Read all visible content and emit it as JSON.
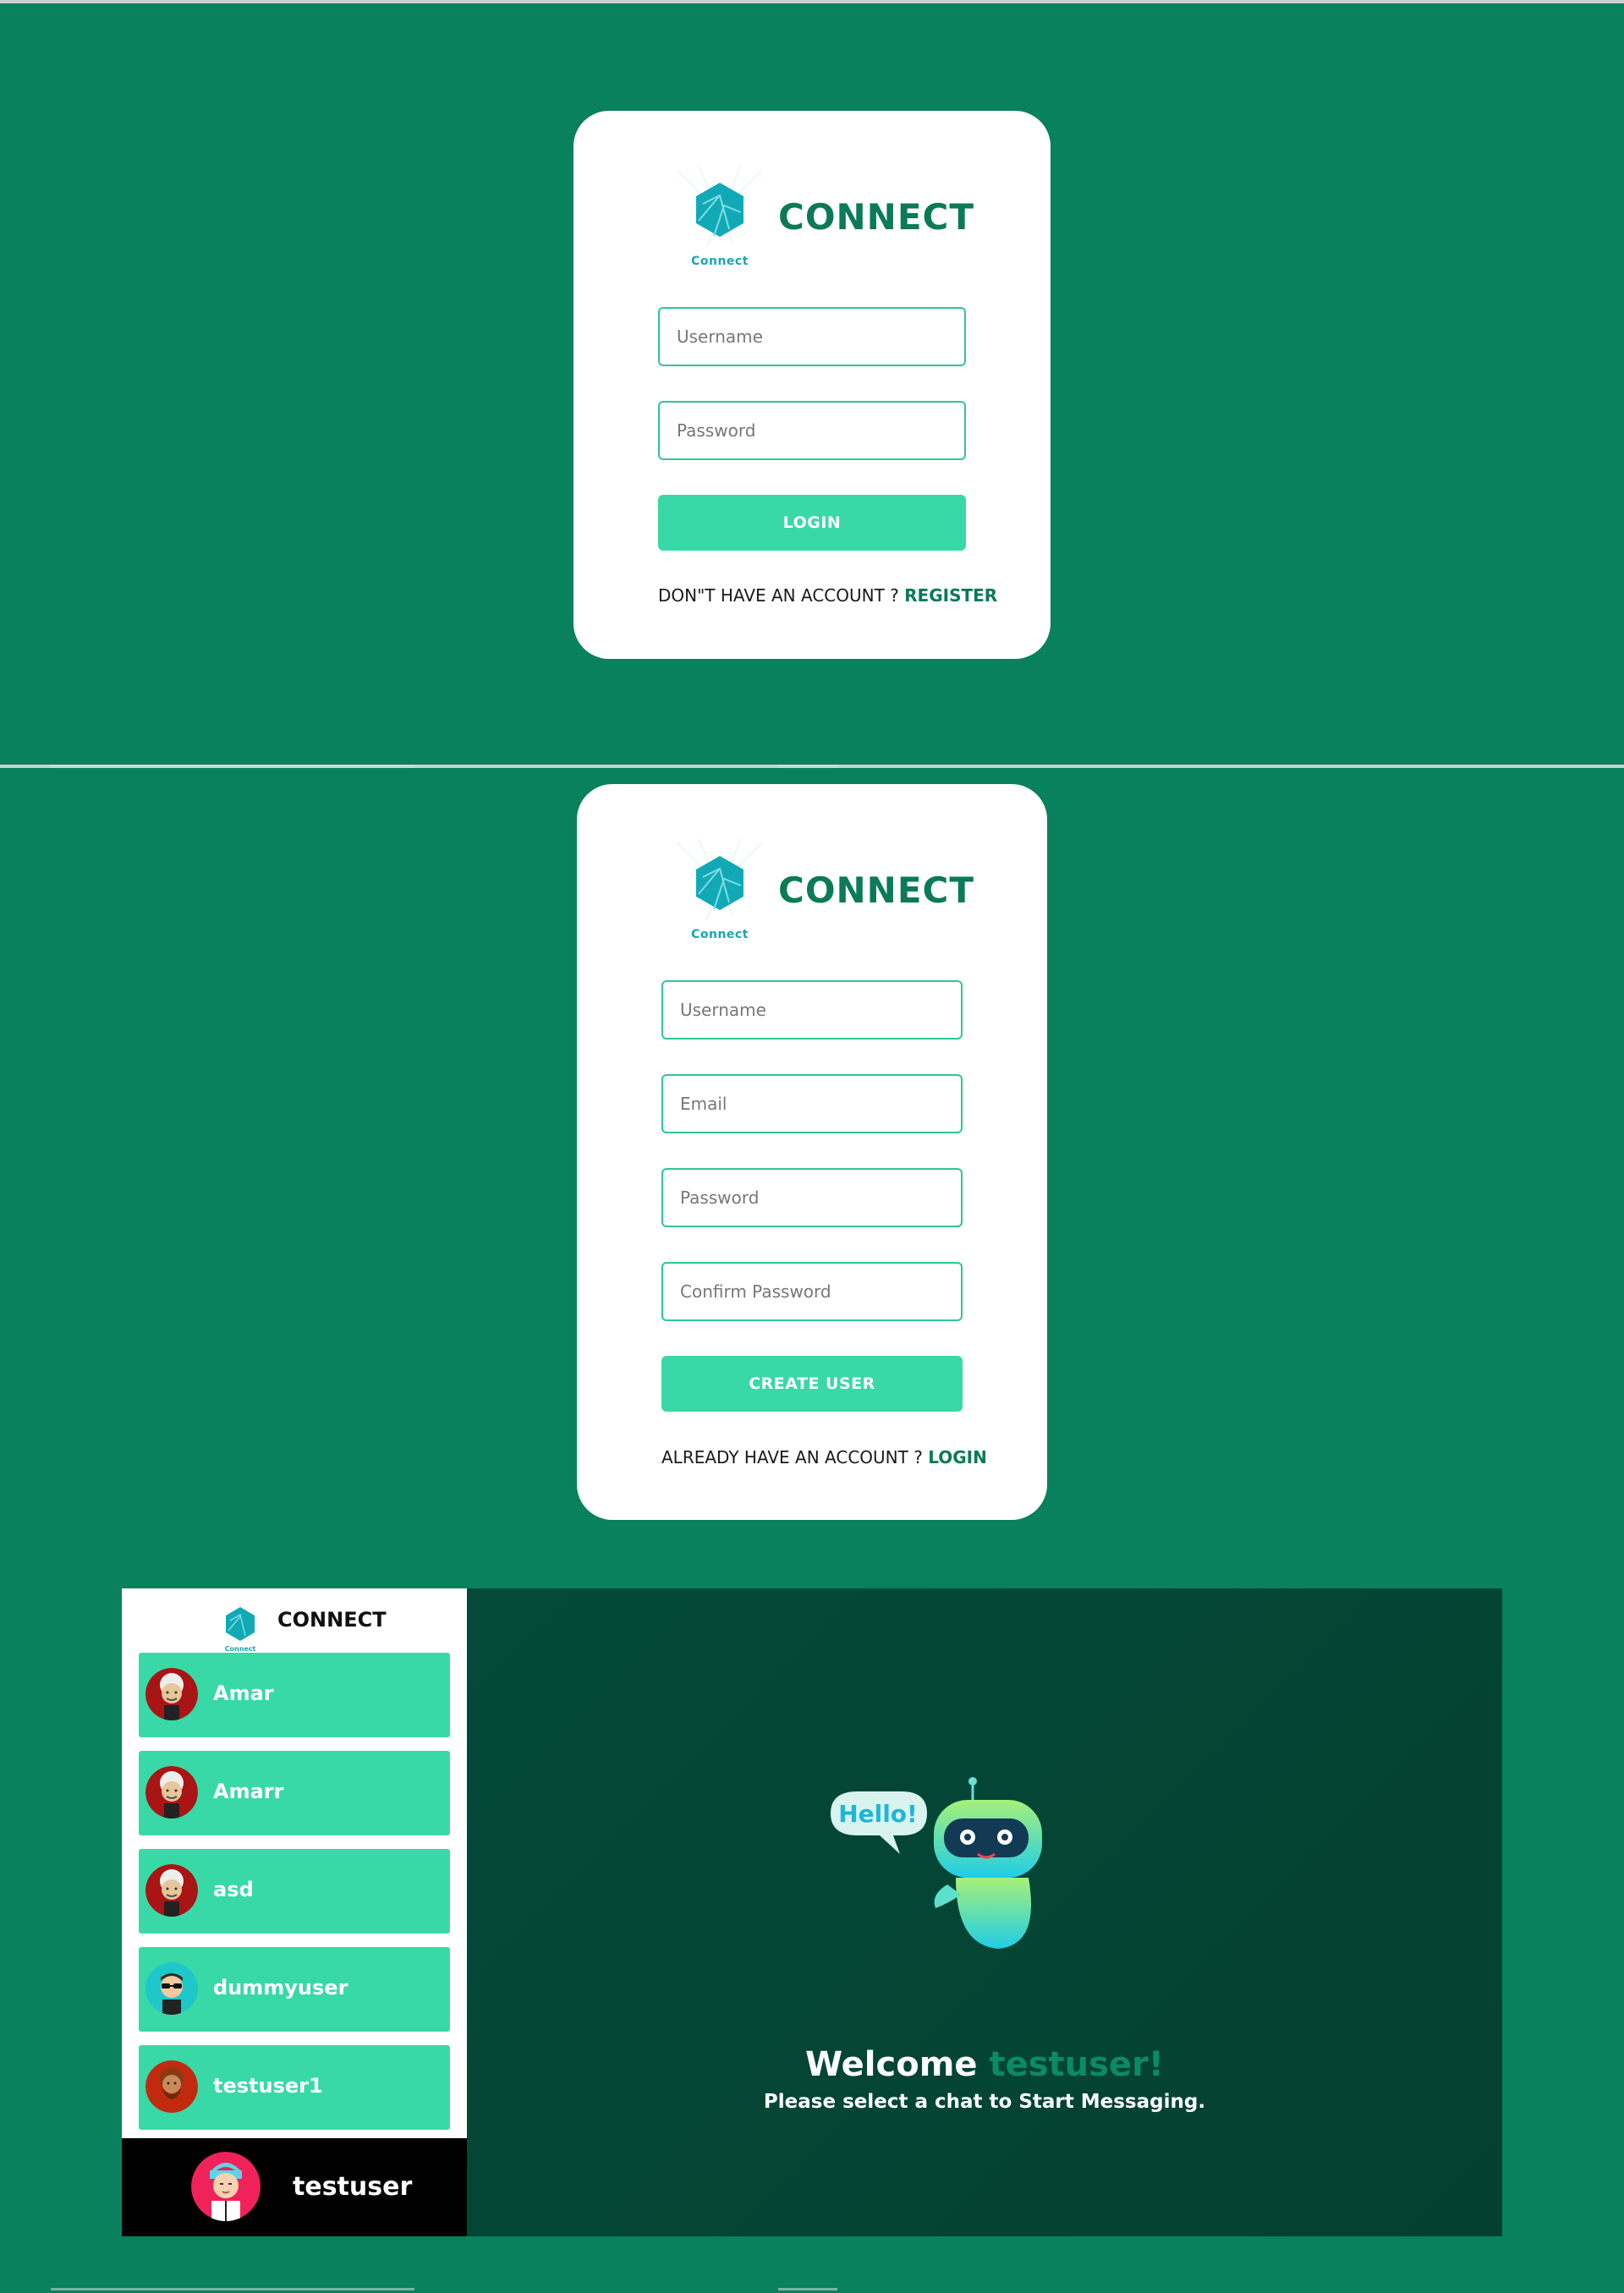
{
  "login": {
    "brand": "CONNECT",
    "logo_caption": "Connect",
    "username_placeholder": "Username",
    "password_placeholder": "Password",
    "submit_label": "LOGIN",
    "prompt_text": "DON\"T HAVE AN ACCOUNT ? ",
    "prompt_link": "REGISTER"
  },
  "register": {
    "brand": "CONNECT",
    "logo_caption": "Connect",
    "username_placeholder": "Username",
    "email_placeholder": "Email",
    "password_placeholder": "Password",
    "confirm_placeholder": "Confirm Password",
    "submit_label": "CREATE USER",
    "prompt_text": "ALREADY HAVE AN ACCOUNT ? ",
    "prompt_link": "LOGIN"
  },
  "chat": {
    "brand": "CONNECT",
    "logo_caption": "Connect",
    "contacts": [
      {
        "name": "Amar",
        "avatar": "white-hair-man-avatar"
      },
      {
        "name": "Amarr",
        "avatar": "white-hair-man-avatar"
      },
      {
        "name": "asd",
        "avatar": "white-hair-man-avatar"
      },
      {
        "name": "dummyuser",
        "avatar": "sunglasses-man-avatar"
      },
      {
        "name": "testuser1",
        "avatar": "bearded-man-avatar"
      }
    ],
    "current_user": {
      "name": "testuser",
      "avatar": "blue-hair-avatar"
    },
    "welcome_prefix": "Welcome ",
    "welcome_user": "testuser!",
    "select_hint": "Please select a chat to Start Messaging.",
    "robot_bubble": "Hello!"
  },
  "colors": {
    "background": "#08815c",
    "accent": "#38d9a6",
    "brand_text": "#0b7a57",
    "chat_panel": "#034a3a"
  }
}
